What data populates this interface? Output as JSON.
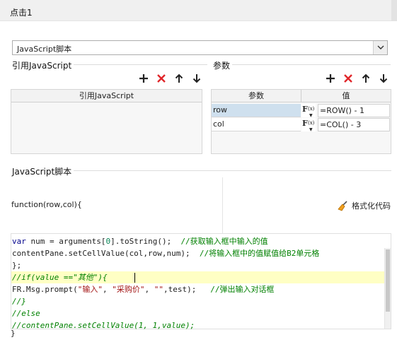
{
  "window": {
    "title": "点击1"
  },
  "script_type": {
    "selected": "JavaScript脚本"
  },
  "ref_js": {
    "title": "引用JavaScript",
    "column": "引用JavaScript"
  },
  "params": {
    "title": "参数",
    "columns": {
      "name": "参数",
      "value": "值"
    },
    "rows": [
      {
        "name": "row",
        "value": "=ROW() - 1"
      },
      {
        "name": "col",
        "value": "=COL() - 3"
      }
    ]
  },
  "js_section": {
    "title": "JavaScript脚本",
    "signature": "function(row,col){",
    "format_button": "格式化代码",
    "closing": "}"
  },
  "code": {
    "lines": [
      {
        "parts": [
          {
            "c": "kw",
            "t": "var"
          },
          {
            "c": "",
            "t": " num = arguments["
          },
          {
            "c": "nm",
            "t": "0"
          },
          {
            "c": "",
            "t": "].toString();  "
          },
          {
            "c": "cm",
            "t": "//获取输入框中输入的值"
          }
        ]
      },
      {
        "parts": [
          {
            "c": "",
            "t": "contentPane.setCellValue(col,row,num);  "
          },
          {
            "c": "cm",
            "t": "//将输入框中的值赋值给B2单元格"
          }
        ]
      },
      {
        "parts": [
          {
            "c": "",
            "t": "};"
          }
        ]
      },
      {
        "parts": [
          {
            "c": "cmi",
            "t": "//if(value ==\"其他\"){"
          }
        ]
      },
      {
        "parts": [
          {
            "c": "",
            "t": "FR.Msg.prompt("
          },
          {
            "c": "st",
            "t": "\"输入\""
          },
          {
            "c": "",
            "t": ", "
          },
          {
            "c": "st",
            "t": "\"采购价\""
          },
          {
            "c": "",
            "t": ", "
          },
          {
            "c": "st",
            "t": "\"\""
          },
          {
            "c": "",
            "t": ",test);   "
          },
          {
            "c": "cm",
            "t": "//弹出输入对话框"
          }
        ]
      },
      {
        "parts": [
          {
            "c": "cmi",
            "t": "//}"
          }
        ]
      },
      {
        "parts": [
          {
            "c": "cmi",
            "t": "//else"
          }
        ]
      },
      {
        "parts": [
          {
            "c": "cmi",
            "t": "//contentPane.setCellValue(1, 1,value);"
          }
        ]
      }
    ]
  },
  "icons": {
    "add": "plus-icon",
    "delete": "delete-x-icon",
    "up": "arrow-up-icon",
    "down": "arrow-down-icon",
    "format": "broom-icon",
    "fx": "formula-icon"
  },
  "colors": {
    "delete": "#e0262a",
    "selected_row": "#cfe0ee",
    "highlight_line": "#ffffc4"
  }
}
